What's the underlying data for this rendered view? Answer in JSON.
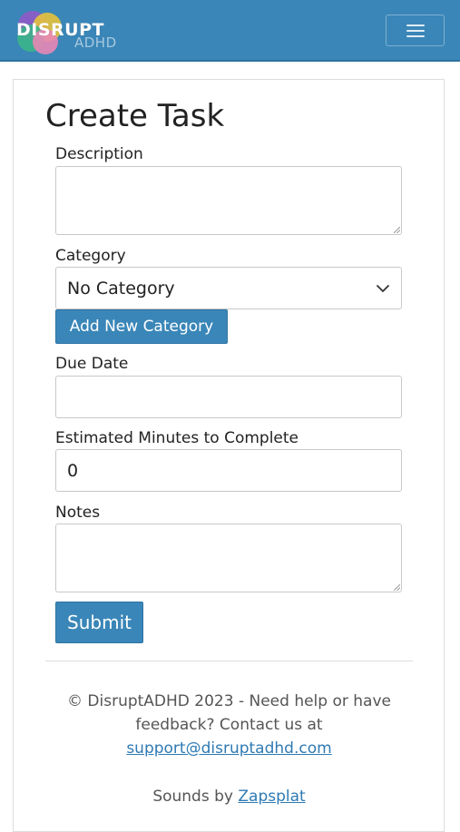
{
  "navbar": {
    "logo_text": "DISRUPT",
    "logo_sub": "ADHD",
    "menu_icon": "hamburger-menu-icon",
    "colors": {
      "bar": "#3a86b8"
    }
  },
  "form": {
    "title": "Create Task",
    "description": {
      "label": "Description",
      "value": ""
    },
    "category": {
      "label": "Category",
      "selected": "No Category",
      "add_button": "Add New Category"
    },
    "due_date": {
      "label": "Due Date",
      "value": ""
    },
    "estimated_minutes": {
      "label": "Estimated Minutes to Complete",
      "value": "0"
    },
    "notes": {
      "label": "Notes",
      "value": ""
    },
    "submit_label": "Submit",
    "accent_color": "#3a86b8"
  },
  "footer": {
    "copyright_line1": "© DisruptADHD 2023 - Need help or have",
    "copyright_line2": "feedback? Contact us at",
    "support_email": "support@disruptadhd.com",
    "sounds_prefix": "Sounds by",
    "sounds_link": "Zapsplat"
  }
}
